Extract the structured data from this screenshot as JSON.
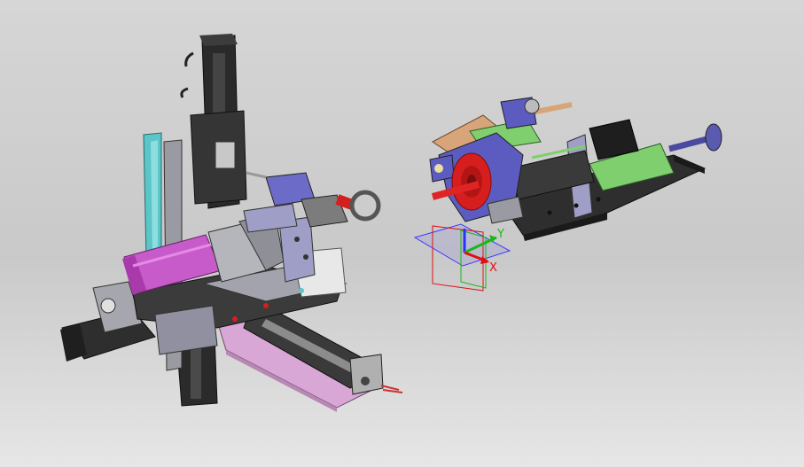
{
  "viewport": {
    "axes": {
      "x_label": "X",
      "y_label": "Y"
    }
  },
  "colors": {
    "bg_top": "#d6d6d6",
    "bg_bottom": "#e6e6e6",
    "black_part": "#2b2b2b",
    "gray_part": "#9a9aa3",
    "magenta": "#c75bc9",
    "cyan": "#5ac6c8",
    "pink": "#d9a7d6",
    "blue_bracket": "#6c6cc8",
    "red_wheel": "#d61e1e",
    "bronze": "#d8a47a",
    "green_part": "#7fcf6f",
    "lavender": "#9e9ec6"
  }
}
